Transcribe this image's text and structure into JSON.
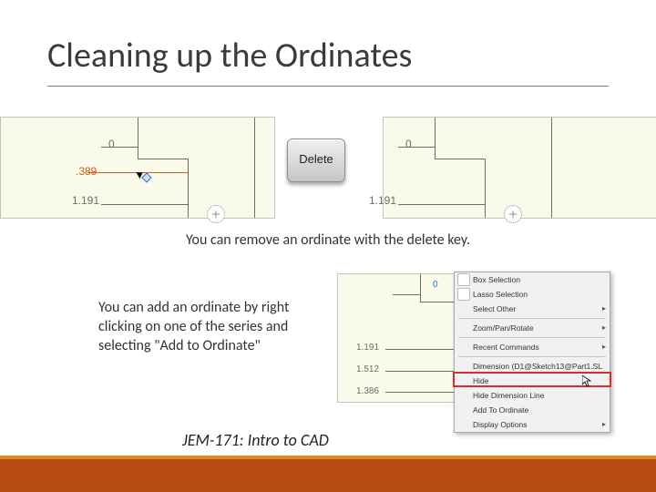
{
  "title": "Cleaning up the Ordinates",
  "footer": "JEM-171: Intro to CAD",
  "caption_delete": "You can remove an ordinate with the delete key.",
  "caption_add": "You can add an ordinate by right clicking on one of the series and selecting \"Add to Ordinate\"",
  "delete_key_label": "Delete",
  "panel_left": {
    "datum": "0",
    "selected": ".389",
    "bottom": "1.191"
  },
  "panel_right": {
    "datum": "0",
    "bottom": "1.191"
  },
  "panel3": {
    "datum": "0",
    "dim1": "1.191",
    "dim2": "1.512",
    "dim3": "1.386"
  },
  "menu": {
    "box_selection": "Box Selection",
    "lasso_selection": "Lasso Selection",
    "select_other": "Select Other",
    "zoom_pan": "Zoom/Pan/Rotate",
    "recent": "Recent Commands",
    "dimension_ref": "Dimension (D1@Sketch13@Part1.SL",
    "hide": "Hide",
    "hide_dim_line": "Hide Dimension Line",
    "add_to_ordinate": "Add To Ordinate",
    "display_options": "Display Options"
  }
}
